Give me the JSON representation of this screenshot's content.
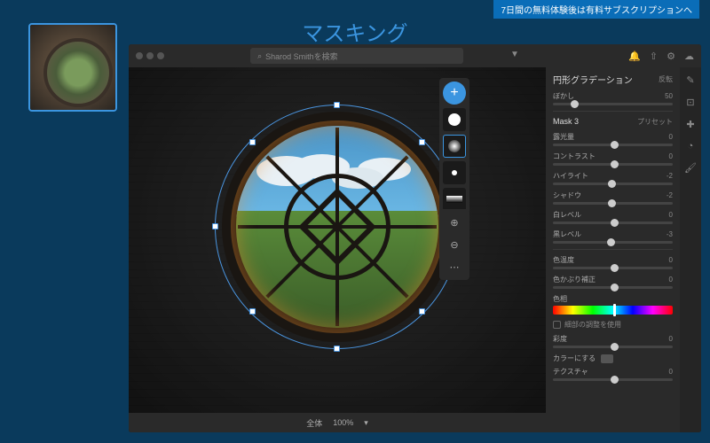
{
  "banner": "7日間の無料体験後は有料サブスクリプションへ",
  "title": "マスキング",
  "search": {
    "placeholder": "Sharod Smithを検索"
  },
  "bottombar": {
    "fit": "全体",
    "zoom": "100%"
  },
  "maskPanel": {
    "addLabel": "+"
  },
  "panel": {
    "header": "円形グラデーション",
    "invert": "反転",
    "maskName": "Mask 3",
    "preset": "プリセット",
    "controls": {
      "blur": {
        "label": "ぼかし",
        "val": "50"
      },
      "exposure": {
        "label": "露光量",
        "val": "0"
      },
      "contrast": {
        "label": "コントラスト",
        "val": "0"
      },
      "highlight": {
        "label": "ハイライト",
        "val": "-2"
      },
      "shadow": {
        "label": "シャドウ",
        "val": "-2"
      },
      "white": {
        "label": "白レベル",
        "val": "0"
      },
      "black": {
        "label": "黒レベル",
        "val": "-3"
      },
      "temp": {
        "label": "色温度",
        "val": "0"
      },
      "tint": {
        "label": "色かぶり補正",
        "val": "0"
      },
      "hue": {
        "label": "色相"
      },
      "detailCheck": "細部の調整を使用",
      "saturation": {
        "label": "彩度",
        "val": "0"
      },
      "colorize": {
        "label": "カラーにする"
      },
      "texture": {
        "label": "テクスチャ",
        "val": "0"
      }
    }
  }
}
